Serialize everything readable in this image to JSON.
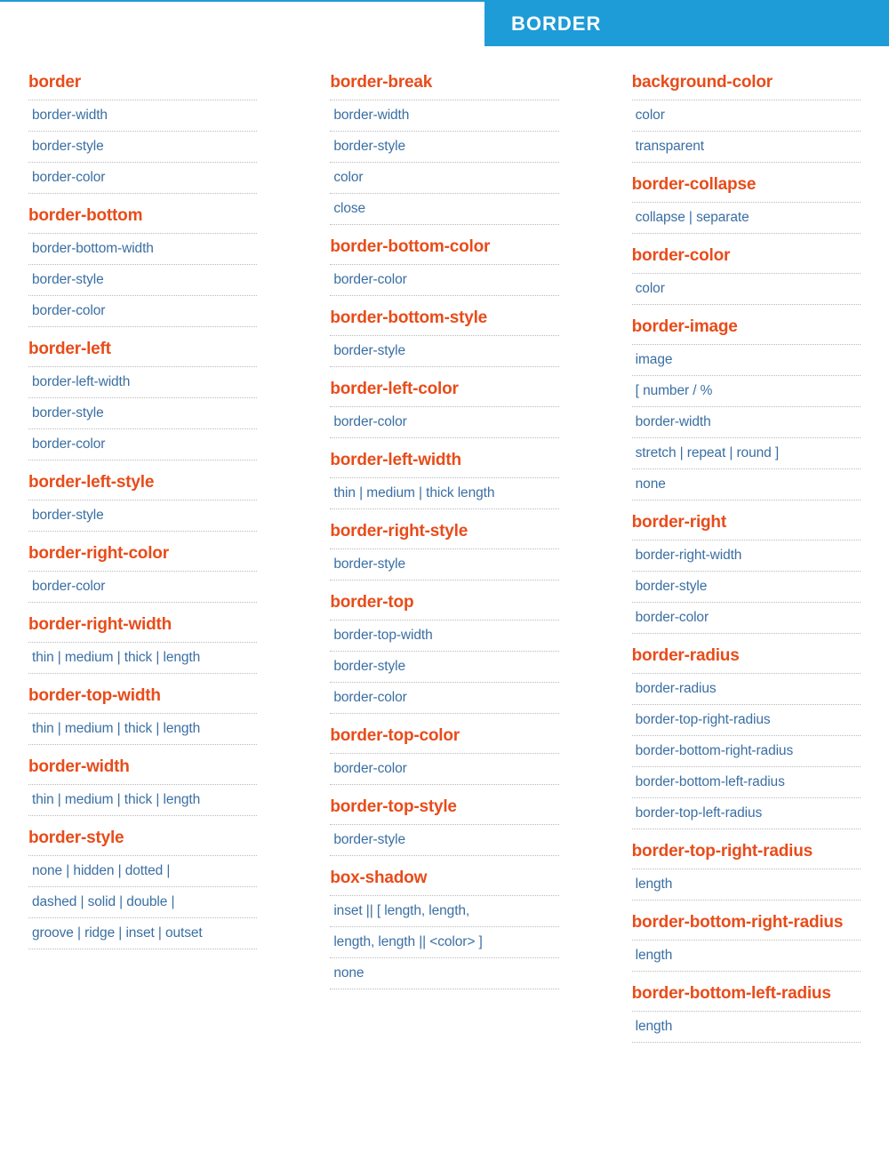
{
  "header": {
    "title": "BORDER"
  },
  "columns": [
    [
      {
        "title": "border",
        "items": [
          "border-width",
          "border-style",
          "border-color"
        ]
      },
      {
        "title": "border-bottom",
        "items": [
          "border-bottom-width",
          "border-style",
          "border-color"
        ]
      },
      {
        "title": "border-left",
        "items": [
          "border-left-width",
          "border-style",
          "border-color"
        ]
      },
      {
        "title": "border-left-style",
        "items": [
          "border-style"
        ]
      },
      {
        "title": "border-right-color",
        "items": [
          "border-color"
        ]
      },
      {
        "title": "border-right-width",
        "items": [
          "thin | medium | thick | length"
        ]
      },
      {
        "title": "border-top-width",
        "items": [
          "thin | medium | thick | length"
        ]
      },
      {
        "title": "border-width",
        "items": [
          "thin | medium | thick | length"
        ]
      },
      {
        "title": "border-style",
        "items": [
          "none | hidden | dotted |",
          "dashed | solid | double |",
          "groove | ridge | inset | outset"
        ]
      }
    ],
    [
      {
        "title": "border-break",
        "items": [
          "border-width",
          "border-style",
          "color",
          "close"
        ]
      },
      {
        "title": "border-bottom-color",
        "items": [
          "border-color"
        ]
      },
      {
        "title": "border-bottom-style",
        "items": [
          "border-style"
        ]
      },
      {
        "title": "border-left-color",
        "items": [
          "border-color"
        ]
      },
      {
        "title": "border-left-width",
        "items": [
          "thin | medium | thick length"
        ]
      },
      {
        "title": "border-right-style",
        "items": [
          "border-style"
        ]
      },
      {
        "title": "border-top",
        "items": [
          "border-top-width",
          "border-style",
          "border-color"
        ]
      },
      {
        "title": "border-top-color",
        "items": [
          "border-color"
        ]
      },
      {
        "title": "border-top-style",
        "items": [
          "border-style"
        ]
      },
      {
        "title": "box-shadow",
        "items": [
          "inset || [ length, length,",
          "length, length || <color> ]",
          "none"
        ]
      }
    ],
    [
      {
        "title": "background-color",
        "items": [
          "color",
          "transparent"
        ]
      },
      {
        "title": "border-collapse",
        "items": [
          "collapse | separate"
        ]
      },
      {
        "title": "border-color",
        "items": [
          "color"
        ]
      },
      {
        "title": "border-image",
        "items": [
          "image",
          "[ number / %",
          "border-width",
          "stretch | repeat | round ]",
          "none"
        ]
      },
      {
        "title": "border-right",
        "items": [
          "border-right-width",
          "border-style",
          "border-color"
        ]
      },
      {
        "title": "border-radius",
        "items": [
          "border-radius",
          "border-top-right-radius",
          "border-bottom-right-radius",
          "border-bottom-left-radius",
          "border-top-left-radius"
        ]
      },
      {
        "title": "border-top-right-radius",
        "items": [
          "length"
        ]
      },
      {
        "title": "border-bottom-right-radius",
        "items": [
          "length"
        ]
      },
      {
        "title": "border-bottom-left-radius",
        "items": [
          "length"
        ]
      }
    ]
  ]
}
